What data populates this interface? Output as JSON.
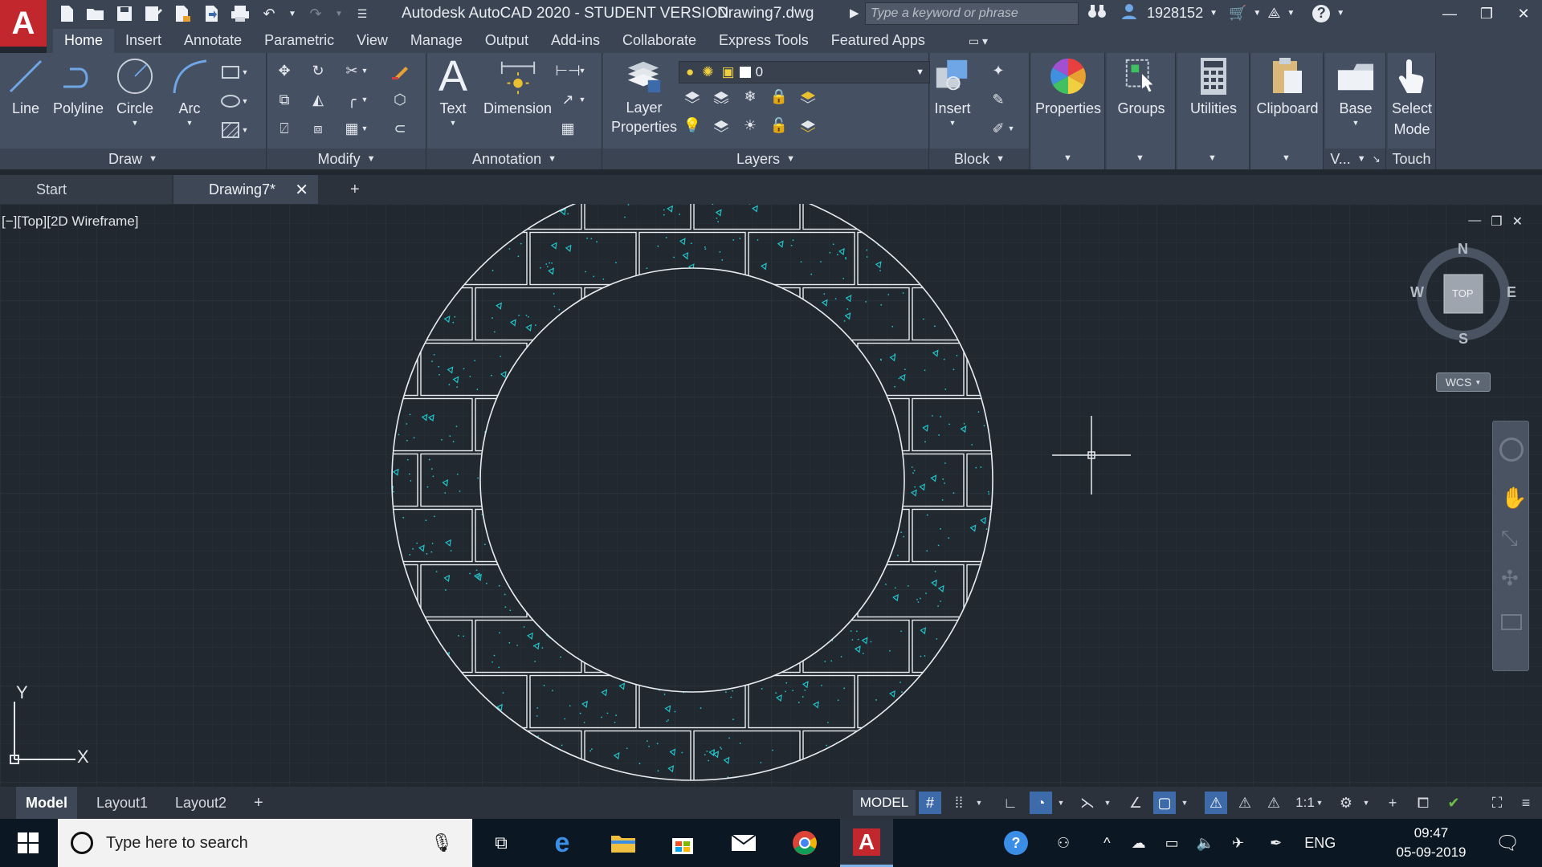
{
  "title_bar": {
    "logo": "A",
    "app_title": "Autodesk AutoCAD 2020 - STUDENT VERSION",
    "file_name": "Drawing7.dwg",
    "search_placeholder": "Type a keyword or phrase",
    "user_id": "1928152",
    "qat_icons": [
      "new-icon",
      "open-icon",
      "save-icon",
      "save-as-icon",
      "plot-icon",
      "import-icon",
      "print-icon",
      "undo-icon",
      "redo-icon",
      "customize-icon"
    ]
  },
  "ribbon_tabs": [
    {
      "label": "Home",
      "active": true
    },
    {
      "label": "Insert"
    },
    {
      "label": "Annotate"
    },
    {
      "label": "Parametric"
    },
    {
      "label": "View"
    },
    {
      "label": "Manage"
    },
    {
      "label": "Output"
    },
    {
      "label": "Add-ins"
    },
    {
      "label": "Collaborate"
    },
    {
      "label": "Express Tools"
    },
    {
      "label": "Featured Apps"
    }
  ],
  "panels": {
    "draw": {
      "title": "Draw",
      "tools": [
        "Line",
        "Polyline",
        "Circle",
        "Arc"
      ]
    },
    "modify": {
      "title": "Modify"
    },
    "annotation": {
      "title": "Annotation",
      "tools": [
        "Text",
        "Dimension"
      ]
    },
    "layers": {
      "title": "Layers",
      "layer_properties_line1": "Layer",
      "layer_properties_line2": "Properties",
      "current_layer": "0"
    },
    "block": {
      "title": "Block",
      "insert": "Insert"
    },
    "properties": {
      "label": "Properties"
    },
    "groups": {
      "label": "Groups"
    },
    "utilities": {
      "label": "Utilities"
    },
    "clipboard": {
      "label": "Clipboard"
    },
    "view": {
      "base": "Base",
      "title": "V..."
    },
    "touch": {
      "line1": "Select",
      "line2": "Mode",
      "title": "Touch"
    }
  },
  "file_tabs": {
    "start": "Start",
    "drawing": "Drawing7*",
    "new_tab": "+"
  },
  "viewport": {
    "label": "[−][Top][2D Wireframe]",
    "viewcube": {
      "n": "N",
      "s": "S",
      "e": "E",
      "w": "W",
      "top": "TOP",
      "wcs": "WCS"
    },
    "ucs": {
      "x": "X",
      "y": "Y"
    }
  },
  "layout_tabs": [
    "Model",
    "Layout1",
    "Layout2"
  ],
  "status_bar": {
    "model": "MODEL",
    "scale": "1:1"
  },
  "taskbar": {
    "search_placeholder": "Type here to search",
    "language": "ENG",
    "time": "09:47",
    "date": "05-09-2019"
  },
  "colors": {
    "hatch": "#22c3c9",
    "canvas": "#212830",
    "autocad_red": "#c1272d"
  }
}
